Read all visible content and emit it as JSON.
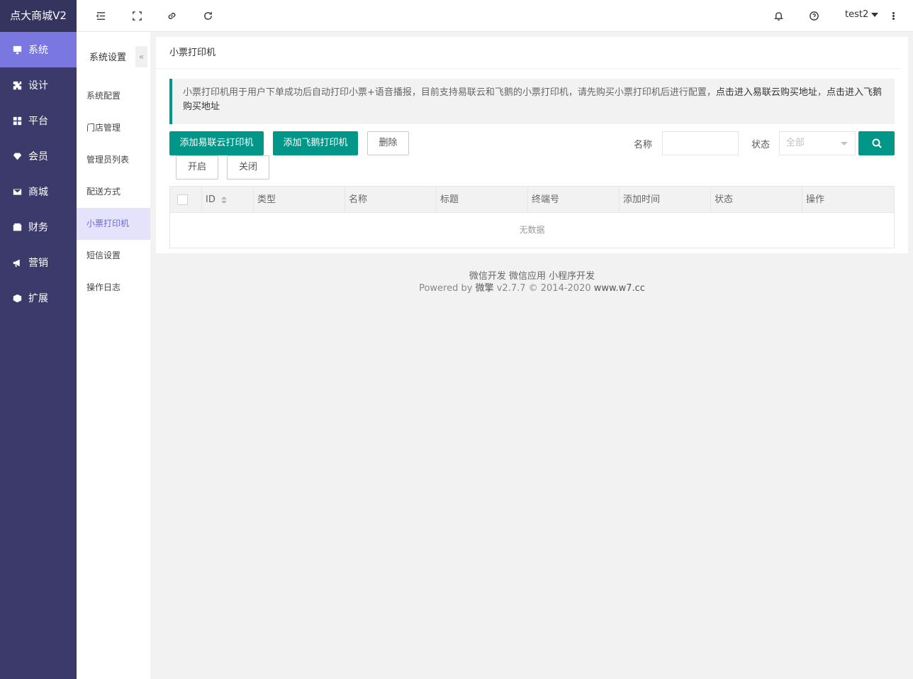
{
  "brand": "点大商城V2",
  "sidebar": {
    "items": [
      {
        "label": "系统",
        "icon": "monitor-icon",
        "active": true
      },
      {
        "label": "设计",
        "icon": "puzzle-icon"
      },
      {
        "label": "平台",
        "icon": "grid-icon"
      },
      {
        "label": "会员",
        "icon": "diamond-icon"
      },
      {
        "label": "商城",
        "icon": "mail-icon"
      },
      {
        "label": "财务",
        "icon": "wallet-icon"
      },
      {
        "label": "营销",
        "icon": "megaphone-icon"
      },
      {
        "label": "扩展",
        "icon": "cube-icon"
      }
    ]
  },
  "subnav": {
    "title": "系统设置",
    "collapse_glyph": "«",
    "items": [
      {
        "label": "系统配置"
      },
      {
        "label": "门店管理"
      },
      {
        "label": "管理员列表"
      },
      {
        "label": "配送方式"
      },
      {
        "label": "小票打印机",
        "active": true
      },
      {
        "label": "短信设置"
      },
      {
        "label": "操作日志"
      }
    ]
  },
  "topbar": {
    "icons": [
      "menu-fold-icon",
      "fullscreen-icon",
      "link-icon",
      "refresh-icon",
      "bell-icon",
      "help-icon"
    ],
    "user": "test2"
  },
  "page": {
    "title": "小票打印机",
    "notice_text": "小票打印机用于用户下单成功后自动打印小票+语音播报，目前支持易联云和飞鹅的小票打印机，请先购买小票打印机后进行配置，",
    "notice_link1": "点击进入易联云购买地址",
    "notice_sep": "，",
    "notice_link2": "点击进入飞鹅购买地址"
  },
  "toolbar": {
    "add_yilianyun": "添加易联云打印机",
    "add_feie": "添加飞鹅打印机",
    "delete": "删除",
    "enable": "开启",
    "disable": "关闭"
  },
  "filters": {
    "name_label": "名称",
    "name_value": "",
    "status_label": "状态",
    "status_value": "全部"
  },
  "table": {
    "columns": [
      "ID",
      "类型",
      "名称",
      "标题",
      "终端号",
      "添加时间",
      "状态",
      "操作"
    ],
    "rows": [],
    "empty_text": "无数据"
  },
  "footer": {
    "links": [
      "微信开发",
      "微信应用",
      "小程序开发"
    ],
    "powered_prefix": "Powered by",
    "powered_brand": "微擎",
    "version": "v2.7.7 © 2014-2020",
    "site": "www.w7.cc"
  },
  "colors": {
    "sidebar_bg": "#3b3a6b",
    "sidebar_active": "#7b77e0",
    "primary": "#009688",
    "subnav_active_bg": "#e4e3fb",
    "subnav_active_text": "#6d69dc"
  }
}
